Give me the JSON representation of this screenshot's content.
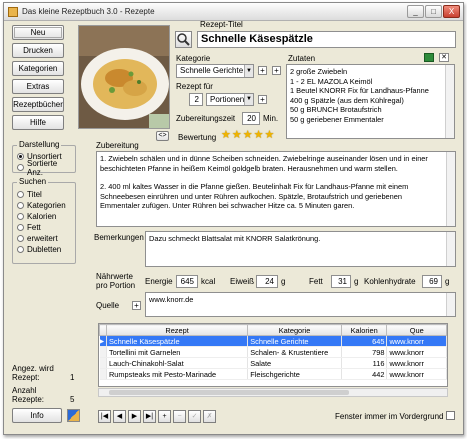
{
  "window": {
    "title": "Das kleine Rezeptbuch 3.0 - Rezepte",
    "min": "_",
    "max": "□",
    "close": "X"
  },
  "buttons": {
    "neu": "Neu",
    "drucken": "Drucken",
    "kategorien": "Kategorien",
    "extras": "Extras",
    "rezeptbuecher": "Rezeptbücher",
    "hilfe": "Hilfe",
    "info": "Info"
  },
  "darstellung": {
    "legend": "Darstellung",
    "options": [
      "Unsortiert",
      "Sortierte Anz."
    ],
    "selected": 0
  },
  "suchen": {
    "legend": "Suchen",
    "options": [
      "Titel",
      "Kategorien",
      "Kalorien",
      "Fett",
      "erweitert",
      "Dubletten"
    ]
  },
  "stats": {
    "angez_label1": "Angez. wird",
    "angez_label2": "Rezept:",
    "angez_value": "1",
    "anzahl_label1": "Anzahl",
    "anzahl_label2": "Rezepte:",
    "anzahl_value": "5"
  },
  "photo_nav": "<>",
  "recipe": {
    "titel_label": "Rezept-Titel",
    "titel": "Schnelle Käsespätzle",
    "kategorie_label": "Kategorie",
    "kategorie": "Schnelle Gerichte",
    "rezept_fuer_label": "Rezept für",
    "portionen_count": "2",
    "portionen_unit": "Portionen",
    "zeit_label": "Zubereitungszeit",
    "zeit_value": "20",
    "zeit_unit": "Min.",
    "bewertung_label": "Bewertung",
    "bewertung": 5,
    "zutaten_label": "Zutaten",
    "zutaten": [
      "2 große Zwiebeln",
      "1 - 2 EL MAZOLA Keimöl",
      "1 Beutel KNORR Fix für Landhaus-Pfanne",
      "400 g Spätzle (aus dem Kühlregal)",
      "50 g BRUNCH Brotaufstrich",
      "50 g geriebener Emmentaler"
    ],
    "zubereitung_label": "Zubereitung",
    "zubereitung": [
      "1. Zwiebeln schälen und in dünne Scheiben schneiden. Zwiebelringe auseinander lösen und in einer beschichteten Pfanne in heißem Keimöl goldgelb braten. Herausnehmen und warm stellen.",
      "2. 400 ml kaltes Wasser in die Pfanne gießen. Beutelinhalt Fix für Landhaus-Pfanne mit einem Schneebesen einrühren und unter Rühren aufkochen. Spätzle, Brotaufstrich und geriebenen Emmentaler zufügen. Unter Rühren bei schwacher Hitze ca. 5 Minuten garen."
    ],
    "bemerkungen_label": "Bemerkungen",
    "bemerkungen": "Dazu schmeckt Blattsalat mit KNORR Salatkrönung.",
    "naehrwerte_label1": "Nährwerte",
    "naehrwerte_label2": "pro Portion",
    "energie_label": "Energie",
    "energie": "645",
    "energie_unit": "kcal",
    "eiweiss_label": "Eiweiß",
    "eiweiss": "24",
    "eiweiss_unit": "g",
    "fett_label": "Fett",
    "fett": "31",
    "fett_unit": "g",
    "kh_label": "Kohlenhydrate",
    "kh": "69",
    "kh_unit": "g",
    "quelle_label": "Quelle",
    "quelle": "www.knorr.de"
  },
  "table": {
    "headers": [
      "Rezept",
      "Kategorie",
      "Kalorien",
      "Que"
    ],
    "rows": [
      [
        "Schnelle Käsespätzle",
        "Schnelle Gerichte",
        "645",
        "www.knorr"
      ],
      [
        "Tortellini mit Garnelen",
        "Schalen- & Krustentiere",
        "798",
        "www.knorr"
      ],
      [
        "Lauch-Chinakohl-Salat",
        "Salate",
        "116",
        "www.knorr"
      ],
      [
        "Rumpsteaks mit Pesto-Marinade",
        "Fleischgerichte",
        "442",
        "www.knorr"
      ]
    ]
  },
  "navigator": [
    "|◀",
    "◀",
    "▶",
    "▶|",
    "+",
    "−",
    "✓",
    "✗"
  ],
  "footer": {
    "fenster_label": "Fenster immer im Vordergrund"
  },
  "colors": {
    "selection": "#3478f6",
    "stars": "#f0b400",
    "window_bg": "#ece9d8"
  },
  "icons": {
    "search": "magnifier-icon",
    "excel": "spreadsheet-icon",
    "close_small": "close-icon"
  }
}
